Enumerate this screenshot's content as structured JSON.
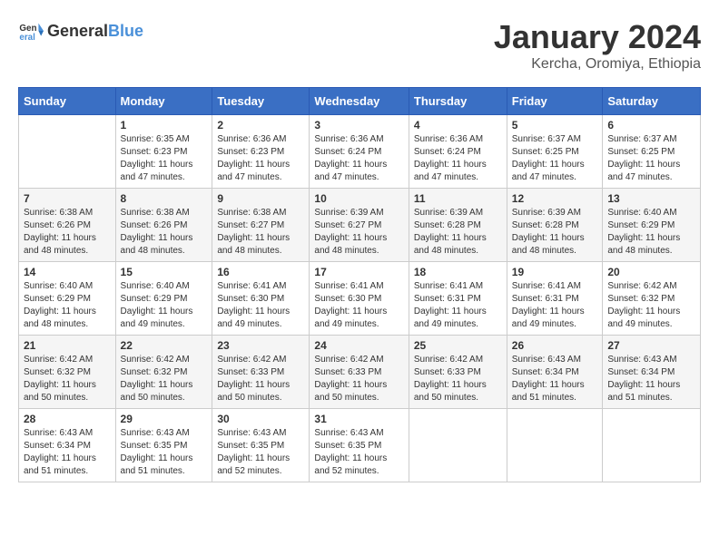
{
  "logo": {
    "general": "General",
    "blue": "Blue"
  },
  "title": "January 2024",
  "location": "Kercha, Oromiya, Ethiopia",
  "days_of_week": [
    "Sunday",
    "Monday",
    "Tuesday",
    "Wednesday",
    "Thursday",
    "Friday",
    "Saturday"
  ],
  "weeks": [
    [
      {
        "day": null,
        "info": null
      },
      {
        "day": "1",
        "info": "Sunrise: 6:35 AM\nSunset: 6:23 PM\nDaylight: 11 hours and 47 minutes."
      },
      {
        "day": "2",
        "info": "Sunrise: 6:36 AM\nSunset: 6:23 PM\nDaylight: 11 hours and 47 minutes."
      },
      {
        "day": "3",
        "info": "Sunrise: 6:36 AM\nSunset: 6:24 PM\nDaylight: 11 hours and 47 minutes."
      },
      {
        "day": "4",
        "info": "Sunrise: 6:36 AM\nSunset: 6:24 PM\nDaylight: 11 hours and 47 minutes."
      },
      {
        "day": "5",
        "info": "Sunrise: 6:37 AM\nSunset: 6:25 PM\nDaylight: 11 hours and 47 minutes."
      },
      {
        "day": "6",
        "info": "Sunrise: 6:37 AM\nSunset: 6:25 PM\nDaylight: 11 hours and 47 minutes."
      }
    ],
    [
      {
        "day": "7",
        "info": "Sunrise: 6:38 AM\nSunset: 6:26 PM\nDaylight: 11 hours and 48 minutes."
      },
      {
        "day": "8",
        "info": "Sunrise: 6:38 AM\nSunset: 6:26 PM\nDaylight: 11 hours and 48 minutes."
      },
      {
        "day": "9",
        "info": "Sunrise: 6:38 AM\nSunset: 6:27 PM\nDaylight: 11 hours and 48 minutes."
      },
      {
        "day": "10",
        "info": "Sunrise: 6:39 AM\nSunset: 6:27 PM\nDaylight: 11 hours and 48 minutes."
      },
      {
        "day": "11",
        "info": "Sunrise: 6:39 AM\nSunset: 6:28 PM\nDaylight: 11 hours and 48 minutes."
      },
      {
        "day": "12",
        "info": "Sunrise: 6:39 AM\nSunset: 6:28 PM\nDaylight: 11 hours and 48 minutes."
      },
      {
        "day": "13",
        "info": "Sunrise: 6:40 AM\nSunset: 6:29 PM\nDaylight: 11 hours and 48 minutes."
      }
    ],
    [
      {
        "day": "14",
        "info": "Sunrise: 6:40 AM\nSunset: 6:29 PM\nDaylight: 11 hours and 48 minutes."
      },
      {
        "day": "15",
        "info": "Sunrise: 6:40 AM\nSunset: 6:29 PM\nDaylight: 11 hours and 49 minutes."
      },
      {
        "day": "16",
        "info": "Sunrise: 6:41 AM\nSunset: 6:30 PM\nDaylight: 11 hours and 49 minutes."
      },
      {
        "day": "17",
        "info": "Sunrise: 6:41 AM\nSunset: 6:30 PM\nDaylight: 11 hours and 49 minutes."
      },
      {
        "day": "18",
        "info": "Sunrise: 6:41 AM\nSunset: 6:31 PM\nDaylight: 11 hours and 49 minutes."
      },
      {
        "day": "19",
        "info": "Sunrise: 6:41 AM\nSunset: 6:31 PM\nDaylight: 11 hours and 49 minutes."
      },
      {
        "day": "20",
        "info": "Sunrise: 6:42 AM\nSunset: 6:32 PM\nDaylight: 11 hours and 49 minutes."
      }
    ],
    [
      {
        "day": "21",
        "info": "Sunrise: 6:42 AM\nSunset: 6:32 PM\nDaylight: 11 hours and 50 minutes."
      },
      {
        "day": "22",
        "info": "Sunrise: 6:42 AM\nSunset: 6:32 PM\nDaylight: 11 hours and 50 minutes."
      },
      {
        "day": "23",
        "info": "Sunrise: 6:42 AM\nSunset: 6:33 PM\nDaylight: 11 hours and 50 minutes."
      },
      {
        "day": "24",
        "info": "Sunrise: 6:42 AM\nSunset: 6:33 PM\nDaylight: 11 hours and 50 minutes."
      },
      {
        "day": "25",
        "info": "Sunrise: 6:42 AM\nSunset: 6:33 PM\nDaylight: 11 hours and 50 minutes."
      },
      {
        "day": "26",
        "info": "Sunrise: 6:43 AM\nSunset: 6:34 PM\nDaylight: 11 hours and 51 minutes."
      },
      {
        "day": "27",
        "info": "Sunrise: 6:43 AM\nSunset: 6:34 PM\nDaylight: 11 hours and 51 minutes."
      }
    ],
    [
      {
        "day": "28",
        "info": "Sunrise: 6:43 AM\nSunset: 6:34 PM\nDaylight: 11 hours and 51 minutes."
      },
      {
        "day": "29",
        "info": "Sunrise: 6:43 AM\nSunset: 6:35 PM\nDaylight: 11 hours and 51 minutes."
      },
      {
        "day": "30",
        "info": "Sunrise: 6:43 AM\nSunset: 6:35 PM\nDaylight: 11 hours and 52 minutes."
      },
      {
        "day": "31",
        "info": "Sunrise: 6:43 AM\nSunset: 6:35 PM\nDaylight: 11 hours and 52 minutes."
      },
      {
        "day": null,
        "info": null
      },
      {
        "day": null,
        "info": null
      },
      {
        "day": null,
        "info": null
      }
    ]
  ]
}
